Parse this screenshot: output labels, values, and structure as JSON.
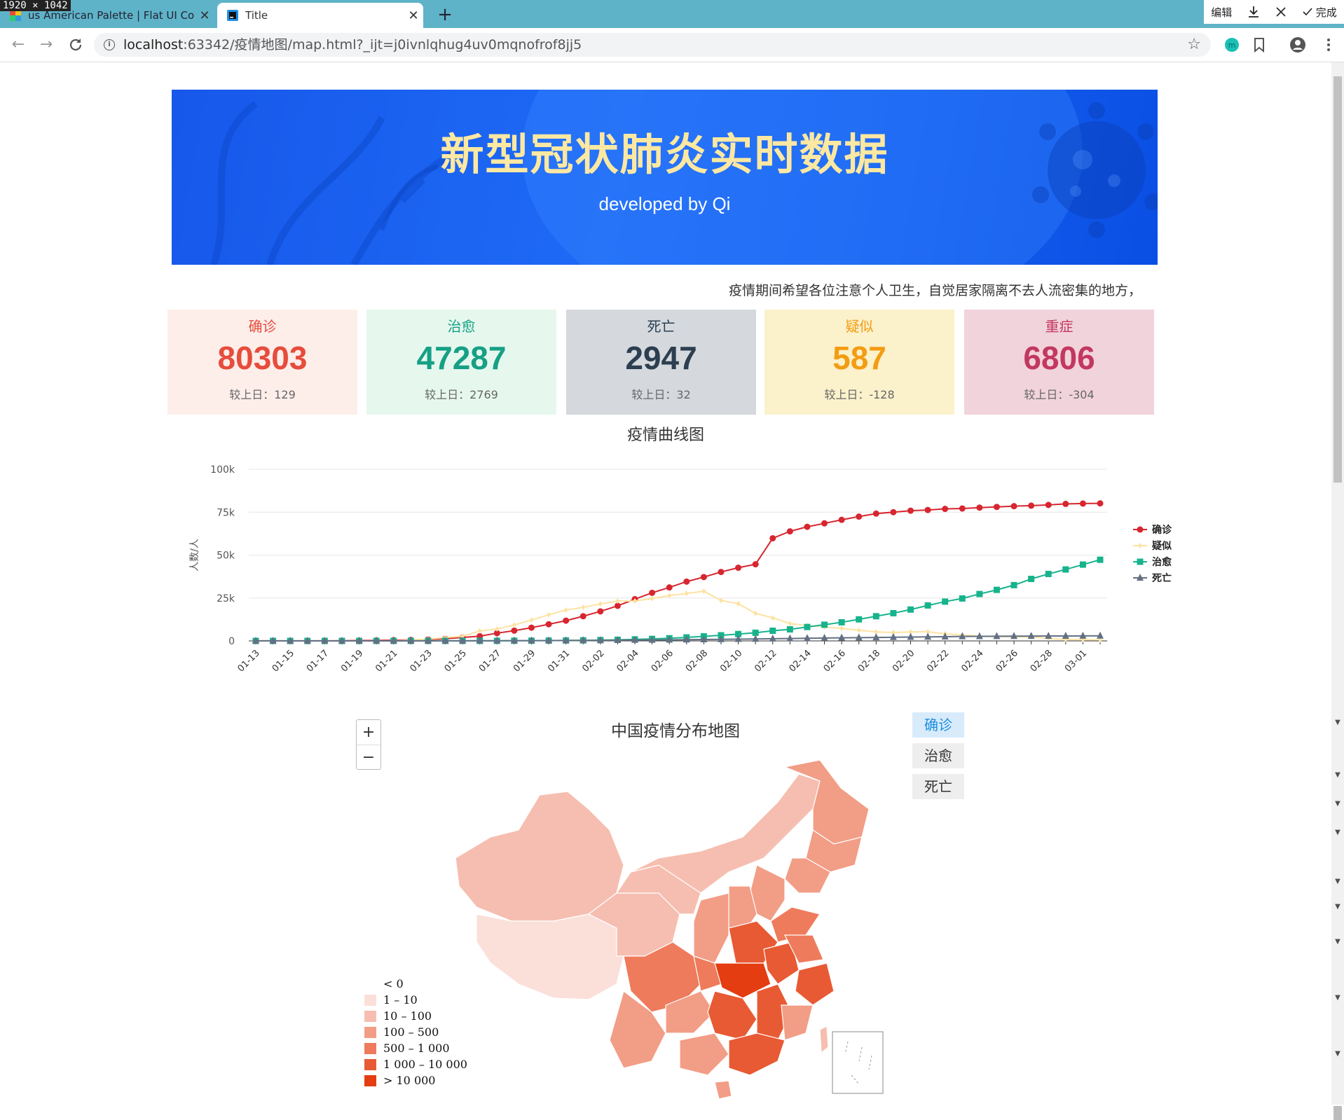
{
  "screenshot_badge": "1920 × 1042",
  "browser": {
    "tabs": [
      {
        "title": "us American Palette | Flat UI Co",
        "active": false
      },
      {
        "title": "Title",
        "active": true
      }
    ],
    "new_tab": "+",
    "url_host": "localhost",
    "url_path": ":63342/疫情地图/map.html?_ijt=j0ivnlqhug4uv0mqnofrof8jj5",
    "download_bar": {
      "edit": "编辑",
      "done": "完成"
    }
  },
  "banner": {
    "title": "新型冠状肺炎实时数据",
    "subtitle": "developed by Qi"
  },
  "notice": "疫情期间希望各位注意个人卫生，自觉居家隔离不去人流密集的地方，",
  "stats": [
    {
      "label": "确诊",
      "value": "80303",
      "delta": "较上日：129",
      "color": "#e74c3c",
      "bg": "#fdeeea"
    },
    {
      "label": "治愈",
      "value": "47287",
      "delta": "较上日：2769",
      "color": "#16a085",
      "bg": "#e6f8ee"
    },
    {
      "label": "死亡",
      "value": "2947",
      "delta": "较上日：32",
      "color": "#2c3e50",
      "bg": "#d5d9dd"
    },
    {
      "label": "疑似",
      "value": "587",
      "delta": "较上日：-128",
      "color": "#f39c12",
      "bg": "#fbf1cb"
    },
    {
      "label": "重症",
      "value": "6806",
      "delta": "较上日：-304",
      "color": "#c23860",
      "bg": "#f1d3dc"
    }
  ],
  "chart_title": "疫情曲线图",
  "chart_data": {
    "type": "line",
    "ylabel": "人数/人",
    "ylim": [
      0,
      100000
    ],
    "yticks": [
      "0",
      "25k",
      "50k",
      "75k",
      "100k"
    ],
    "x": [
      "01-13",
      "01-14",
      "01-15",
      "01-16",
      "01-17",
      "01-18",
      "01-19",
      "01-20",
      "01-21",
      "01-22",
      "01-23",
      "01-24",
      "01-25",
      "01-26",
      "01-27",
      "01-28",
      "01-29",
      "01-30",
      "01-31",
      "02-01",
      "02-02",
      "02-03",
      "02-04",
      "02-05",
      "02-06",
      "02-07",
      "02-08",
      "02-09",
      "02-10",
      "02-11",
      "02-12",
      "02-13",
      "02-14",
      "02-15",
      "02-16",
      "02-17",
      "02-18",
      "02-19",
      "02-20",
      "02-21",
      "02-22",
      "02-23",
      "02-24",
      "02-25",
      "02-26",
      "02-27",
      "02-28",
      "02-29",
      "03-01",
      "03-02"
    ],
    "xticks_shown": [
      "01-13",
      "01-15",
      "01-17",
      "01-19",
      "01-21",
      "01-23",
      "01-25",
      "01-27",
      "01-29",
      "01-31",
      "02-02",
      "02-04",
      "02-06",
      "02-08",
      "02-10",
      "02-12",
      "02-14",
      "02-16",
      "02-18",
      "02-20",
      "02-22",
      "02-24",
      "02-26",
      "02-28",
      "03-01"
    ],
    "legend_position": "right",
    "grid": true,
    "series": [
      {
        "name": "确诊",
        "color": "#d7262f",
        "marker": "circle",
        "values": [
          41,
          41,
          41,
          45,
          62,
          121,
          198,
          291,
          440,
          571,
          830,
          1287,
          1975,
          2744,
          4515,
          5974,
          7711,
          9692,
          11791,
          14380,
          17205,
          20438,
          24324,
          28018,
          31161,
          34546,
          37198,
          40171,
          42638,
          44653,
          59804,
          63851,
          66492,
          68500,
          70548,
          72436,
          74185,
          75002,
          75891,
          76288,
          76936,
          77150,
          77658,
          78064,
          78497,
          78824,
          79251,
          79824,
          80026,
          80151
        ]
      },
      {
        "name": "疑似",
        "color": "#fde3a2",
        "marker": "diamond",
        "values": [
          0,
          0,
          0,
          0,
          0,
          0,
          0,
          54,
          37,
          393,
          1072,
          1965,
          2684,
          5794,
          6973,
          9239,
          12167,
          15238,
          17988,
          19544,
          21558,
          23214,
          23260,
          24702,
          26359,
          27657,
          28942,
          23589,
          21675,
          16067,
          13435,
          10109,
          8969,
          8228,
          7264,
          6242,
          5248,
          4922,
          5206,
          5365,
          4148,
          3434,
          2824,
          2491,
          2358,
          2308,
          1418,
          851,
          715,
          587
        ]
      },
      {
        "name": "治愈",
        "color": "#17b38c",
        "marker": "square",
        "values": [
          0,
          0,
          0,
          0,
          0,
          0,
          0,
          25,
          25,
          28,
          34,
          38,
          49,
          51,
          60,
          103,
          124,
          171,
          243,
          328,
          475,
          632,
          892,
          1153,
          1540,
          2050,
          2649,
          3281,
          3996,
          4740,
          5911,
          6723,
          8096,
          9419,
          10844,
          12552,
          14376,
          16155,
          18264,
          20659,
          22888,
          24734,
          27323,
          29745,
          32495,
          36117,
          39002,
          41625,
          44462,
          47287
        ]
      },
      {
        "name": "死亡",
        "color": "#637083",
        "marker": "triangle",
        "values": [
          1,
          1,
          2,
          2,
          2,
          3,
          4,
          6,
          9,
          17,
          25,
          41,
          56,
          80,
          106,
          132,
          170,
          213,
          259,
          304,
          361,
          425,
          490,
          563,
          636,
          722,
          811,
          908,
          1016,
          1113,
          1259,
          1380,
          1523,
          1665,
          1770,
          1868,
          2004,
          2118,
          2236,
          2345,
          2442,
          2592,
          2663,
          2715,
          2744,
          2788,
          2835,
          2870,
          2912,
          2947
        ]
      }
    ]
  },
  "map": {
    "title": "中国疫情分布地图",
    "zoom_in": "+",
    "zoom_out": "−",
    "tabs": [
      "确诊",
      "治愈",
      "死亡"
    ],
    "legend": [
      {
        "label": "< 0",
        "color": "#ffffff"
      },
      {
        "label": "1 – 10",
        "color": "#fbe0d9"
      },
      {
        "label": "10 – 100",
        "color": "#f6beb0"
      },
      {
        "label": "100 – 500",
        "color": "#f29d86"
      },
      {
        "label": "500 – 1 000",
        "color": "#ee7b5c"
      },
      {
        "label": "1 000 – 10 000",
        "color": "#e85a33"
      },
      {
        "label": "> 10 000",
        "color": "#e43d12"
      }
    ]
  }
}
